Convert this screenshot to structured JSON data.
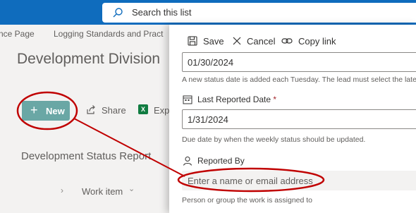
{
  "search": {
    "placeholder": "Search this list"
  },
  "breadcrumbs": [
    "nce Page",
    "Logging Standards and Pract"
  ],
  "page": {
    "title": "Development Division"
  },
  "commands": {
    "new_label": "New",
    "share_label": "Share",
    "export_label": "Exp"
  },
  "view": {
    "title": "Development Status Report",
    "column": "Work item"
  },
  "panel": {
    "save_label": "Save",
    "cancel_label": "Cancel",
    "copy_link_label": "Copy link",
    "status_date": {
      "value": "01/30/2024",
      "help": "A new status date is added each Tuesday. The lead must select the latest"
    },
    "last_reported": {
      "label": "Last Reported Date",
      "required_mark": "*",
      "value": "1/31/2024",
      "help": "Due date by when the weekly status should be updated."
    },
    "reported_by": {
      "label": "Reported By",
      "placeholder": "Enter a name or email address",
      "help": "Person or group the work is assigned to"
    }
  },
  "colors": {
    "topbar": "#0f6cbd",
    "new_button": "#6aa7a5",
    "annotation": "#c00000"
  }
}
